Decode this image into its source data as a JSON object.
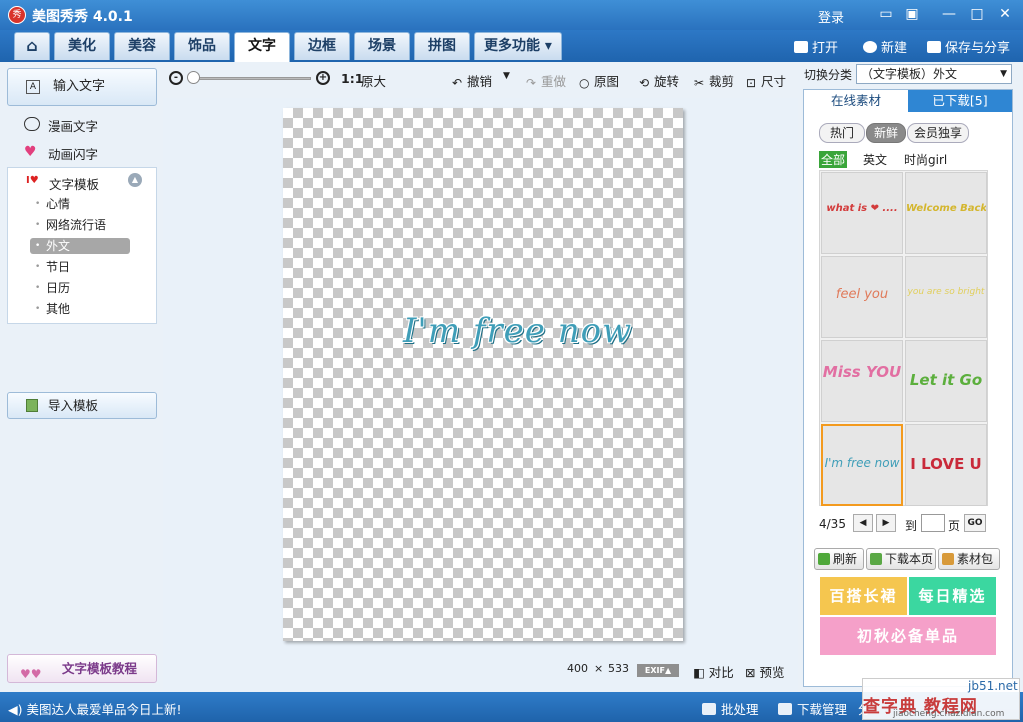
{
  "app": {
    "title": "美图秀秀 4.0.1",
    "logo_text": "秀",
    "login": "登录"
  },
  "nav": {
    "tabs": [
      {
        "label": "美化"
      },
      {
        "label": "美容"
      },
      {
        "label": "饰品"
      },
      {
        "label": "文字"
      },
      {
        "label": "边框"
      },
      {
        "label": "场景"
      },
      {
        "label": "拼图"
      },
      {
        "label": "更多功能 ▾"
      }
    ],
    "active_tab": "文字",
    "actions": {
      "open": "打开",
      "new": "新建",
      "save": "保存与分享"
    }
  },
  "left": {
    "input_text": "输入文字",
    "comic_text": "漫画文字",
    "animated_text": "动画闪字",
    "template_header": "文字模板",
    "template_items": [
      "心情",
      "网络流行语",
      "外文",
      "节日",
      "日历",
      "其他"
    ],
    "selected_item": "外文",
    "import_template": "导入模板",
    "tutorial": "文字模板教程"
  },
  "toolbar": {
    "zoom_ratio": "1:1",
    "original_size": "原大",
    "undo": "撤销",
    "redo": "重做",
    "original_image": "原图",
    "rotate": "旋转",
    "crop": "裁剪",
    "size": "尺寸"
  },
  "canvas": {
    "text": "I'm free now",
    "width": "400",
    "times": "×",
    "height": "533",
    "exif": "EXIF▲",
    "compare": "对比",
    "preview": "预览"
  },
  "right": {
    "category_label": "切换分类",
    "category_value": "（文字模板）外文",
    "tab_online": "在线素材",
    "tab_downloaded": "已下载[5]",
    "filters": [
      "热门",
      "新鲜",
      "会员独享"
    ],
    "active_filter": "新鲜",
    "sub_filters": [
      "全部",
      "英文",
      "时尚girl"
    ],
    "active_sub_filter": "全部",
    "thumbnails": [
      {
        "text": "what is ❤ ....",
        "color": "#d33b3b"
      },
      {
        "text": "Welcome Back!",
        "color": "#d4b62e"
      },
      {
        "text": "feel you",
        "color": "#e07a5a"
      },
      {
        "text": "you are so bright",
        "color": "#e1cf5c"
      },
      {
        "text": "Miss YOU",
        "color": "#e26fa2"
      },
      {
        "text": "Let it Go",
        "color": "#5caf3d"
      },
      {
        "text": "I'm free now",
        "color": "#3f9eb8"
      },
      {
        "text": "I LOVE U",
        "color": "#c92a3a"
      }
    ],
    "pager": {
      "current": "4/35",
      "goto_label": "到",
      "page_label": "页",
      "go": "GO"
    },
    "refresh": "刷新",
    "download_page": "下载本页",
    "material_pack": "素材包",
    "promos": [
      {
        "text": "百搭长裙",
        "color": "#f5c64f"
      },
      {
        "text": "每日精选",
        "color": "#3bd7a0"
      },
      {
        "text": "初秋必备单品",
        "color": "#f5a0c9"
      }
    ]
  },
  "status": {
    "news": "美图达人最爱单品今日上新!",
    "batch": "批处理",
    "download_manager": "下载管理",
    "share": "分"
  },
  "watermark": {
    "site": "jb51.net",
    "brand": "查字典 教程网",
    "url": "jiaocheng.chazidian.com"
  }
}
